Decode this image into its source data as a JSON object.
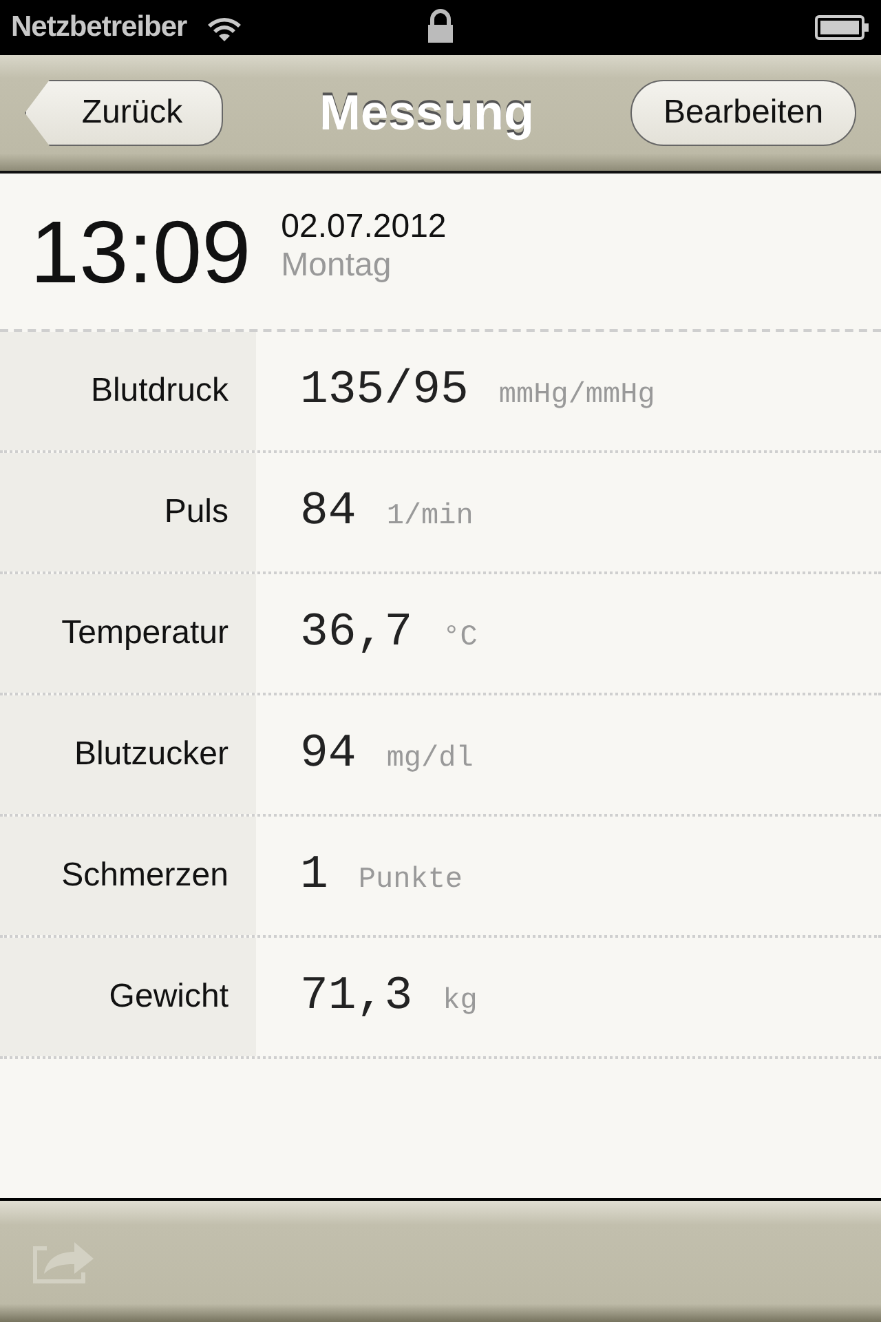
{
  "status_bar": {
    "carrier": "Netzbetreiber"
  },
  "nav_bar": {
    "back": "Zurück",
    "title": "Messung",
    "action": "Bearbeiten"
  },
  "header": {
    "time": "13:09",
    "date": "02.07.2012",
    "weekday": "Montag"
  },
  "measurements": [
    {
      "label": "Blutdruck",
      "value": "135/95",
      "unit": "mmHg/mmHg"
    },
    {
      "label": "Puls",
      "value": "84",
      "unit": "1/min"
    },
    {
      "label": "Temperatur",
      "value": "36,7",
      "unit": "°C"
    },
    {
      "label": "Blutzucker",
      "value": "94",
      "unit": "mg/dl"
    },
    {
      "label": "Schmerzen",
      "value": "1",
      "unit": "Punkte"
    },
    {
      "label": "Gewicht",
      "value": "71,3",
      "unit": "kg"
    }
  ],
  "toolbar": {
    "share_disabled": true
  }
}
